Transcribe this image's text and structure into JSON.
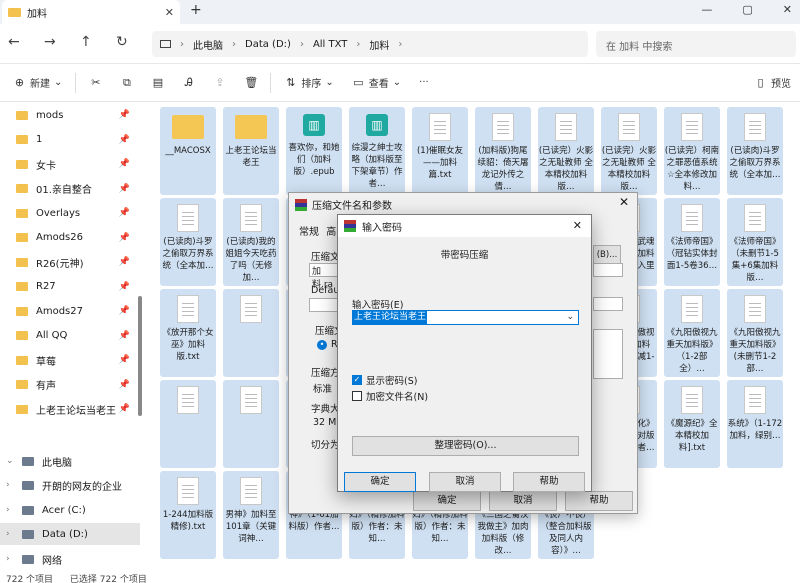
{
  "tab": {
    "title": "加料",
    "close": "✕",
    "new": "+"
  },
  "window": {
    "min": "—",
    "max": "▢",
    "close": "✕"
  },
  "breadcrumbs": [
    "此电脑",
    "Data (D:)",
    "All TXT",
    "加料"
  ],
  "search_placeholder": "在 加料 中搜索",
  "toolbar": {
    "new": "新建",
    "sort": "排序",
    "view": "查看",
    "preview": "预览"
  },
  "sidebar": {
    "pinned": [
      "mods",
      "1",
      "女卡",
      "01.亲自整合",
      "Overlays",
      "Amods26",
      "R26(元神)",
      "R27",
      "Amods27",
      "All QQ",
      "草莓",
      "有声",
      "上老王论坛当老王"
    ],
    "bottom": [
      {
        "label": "此电脑",
        "icon": "pc-icon"
      },
      {
        "label": "开朗的网友的企业",
        "icon": "cloud-icon"
      },
      {
        "label": "Acer (C:)",
        "icon": "drive-icon"
      },
      {
        "label": "Data (D:)",
        "icon": "drive-icon"
      },
      {
        "label": "网络",
        "icon": "network-icon"
      }
    ]
  },
  "files": [
    {
      "name": "__MACOSX",
      "type": "folder"
    },
    {
      "name": "上老王论坛当老王",
      "type": "folder"
    },
    {
      "name": "喜欢你，和她们（加料版）.epub",
      "type": "epub"
    },
    {
      "name": "综漫之绅士攻略（加料版至下架章节）作者…",
      "type": "epub"
    },
    {
      "name": "(1)催眠女友——加料篇.txt",
      "type": "doc"
    },
    {
      "name": "(加料版)狗尾续貂：倚天屠龙记外传之倩…",
      "type": "doc"
    },
    {
      "name": "(已读完）火影之无耻教师 全本精校加料版…",
      "type": "doc"
    },
    {
      "name": "(已读完）火影之无耻教师 全本精校加料版…",
      "type": "doc"
    },
    {
      "name": "(已读完）柯南之罪恶值系统☆全本修改加料…",
      "type": "doc"
    },
    {
      "name": "(已读肉)斗罗之偷取万界系统（全本加…",
      "type": "doc"
    },
    {
      "name": "(已读肉)斗罗之偷取万界系统（全本加…",
      "type": "doc"
    },
    {
      "name": "(已读肉)我的姐姐今天吃药了吗（无修加…",
      "type": "doc"
    },
    {
      "name": "",
      "type": "doc"
    },
    {
      "name": "",
      "type": "doc"
    },
    {
      "name": "",
      "type": "doc"
    },
    {
      "name": "",
      "type": "doc"
    },
    {
      "name": "我…二代",
      "type": "doc"
    },
    {
      "name": "《斗罗之武魂手术刀》加料（全集插入里番…",
      "type": "doc"
    },
    {
      "name": "《法师帝国》（冠钻实体封面1-5卷36…",
      "type": "doc"
    },
    {
      "name": "《法师帝国》（未删节1-5集+6集加料版…",
      "type": "doc"
    },
    {
      "name": "《放开那个女巫》加料版.txt",
      "type": "doc"
    },
    {
      "name": "",
      "type": "doc"
    },
    {
      "name": "",
      "type": "doc"
    },
    {
      "name": "",
      "type": "doc"
    },
    {
      "name": "",
      "type": "doc"
    },
    {
      "name": "《秦…",
      "type": "doc"
    },
    {
      "name": "《九阳（傲视九重天加料版）》（1-2部全…",
      "type": "doc"
    },
    {
      "name": "《九阳（傲视九重天加料版）》（无减1-2…",
      "type": "doc"
    },
    {
      "name": "《九阳傲视九重天加料版》（1-2部全）…",
      "type": "doc"
    },
    {
      "name": "《九阳傲视九重天加料版》(未删节1-2部…",
      "type": "doc"
    },
    {
      "name": "",
      "type": "doc"
    },
    {
      "name": "",
      "type": "doc"
    },
    {
      "name": "",
      "type": "doc"
    },
    {
      "name": "",
      "type": "doc"
    },
    {
      "name": "财…（",
      "type": "doc"
    },
    {
      "name": "《美利坚财富人生》_1-2331修改重制…",
      "type": "doc"
    },
    {
      "name": "《梦幻香江（调教香江）》（五改精修加料版…",
      "type": "doc"
    },
    {
      "name": "《梦想进化》（加料校对版全本）作者…",
      "type": "doc"
    },
    {
      "name": "《魔源纪》全本精校加料].txt",
      "type": "doc"
    },
    {
      "name": "系统》（1-172加料，绿别…",
      "type": "doc"
    },
    {
      "name": "1-244加料版精修).txt",
      "type": "doc"
    },
    {
      "name": "男神》加料至101章（关键词神…",
      "type": "doc"
    },
    {
      "name": "神》（1-61加料版）作者…",
      "type": "doc"
    },
    {
      "name": "妇》（精修加料版）作者：未知…",
      "type": "doc"
    },
    {
      "name": "妇》（精修加料版）作者：未知…",
      "type": "doc"
    },
    {
      "name": "《三国之蜀汉我做主》加肉加料版（修改…",
      "type": "doc"
    },
    {
      "name": "《丧尸不丧尸（整合加料版及同人内容）》…",
      "type": "doc"
    }
  ],
  "status": {
    "count": "722 个项目",
    "selected": "已选择 722 个项目"
  },
  "compress_dialog": {
    "title": "压缩文件名和参数",
    "tabs": [
      "常规",
      "高"
    ],
    "labels": [
      "压缩文件",
      "Default",
      "压缩文",
      "压缩方",
      "字典大",
      "切分为"
    ],
    "archive_value": "加料.ra",
    "method_value": "标准",
    "dict_value": "32 MB",
    "option_r": "RA",
    "browse": "(B)...",
    "ok": "确定",
    "cancel": "取消",
    "help": "帮助",
    "right_bits": [
      "我",
      "二代",
      "春秦",
      "（",
      "财",
      "（"
    ]
  },
  "password_dialog": {
    "title": "输入密码",
    "subtitle": "带密码压缩",
    "field_label": "输入密码(E)",
    "password": "上老王论坛当老王",
    "show_password": "显示密码(S)",
    "encrypt_names": "加密文件名(N)",
    "organize": "整理密码(O)...",
    "ok": "确定",
    "cancel": "取消",
    "help": "帮助"
  },
  "colors": {
    "tile": "#cfe0f2",
    "accent": "#0078d7",
    "folder": "#f4c653"
  }
}
